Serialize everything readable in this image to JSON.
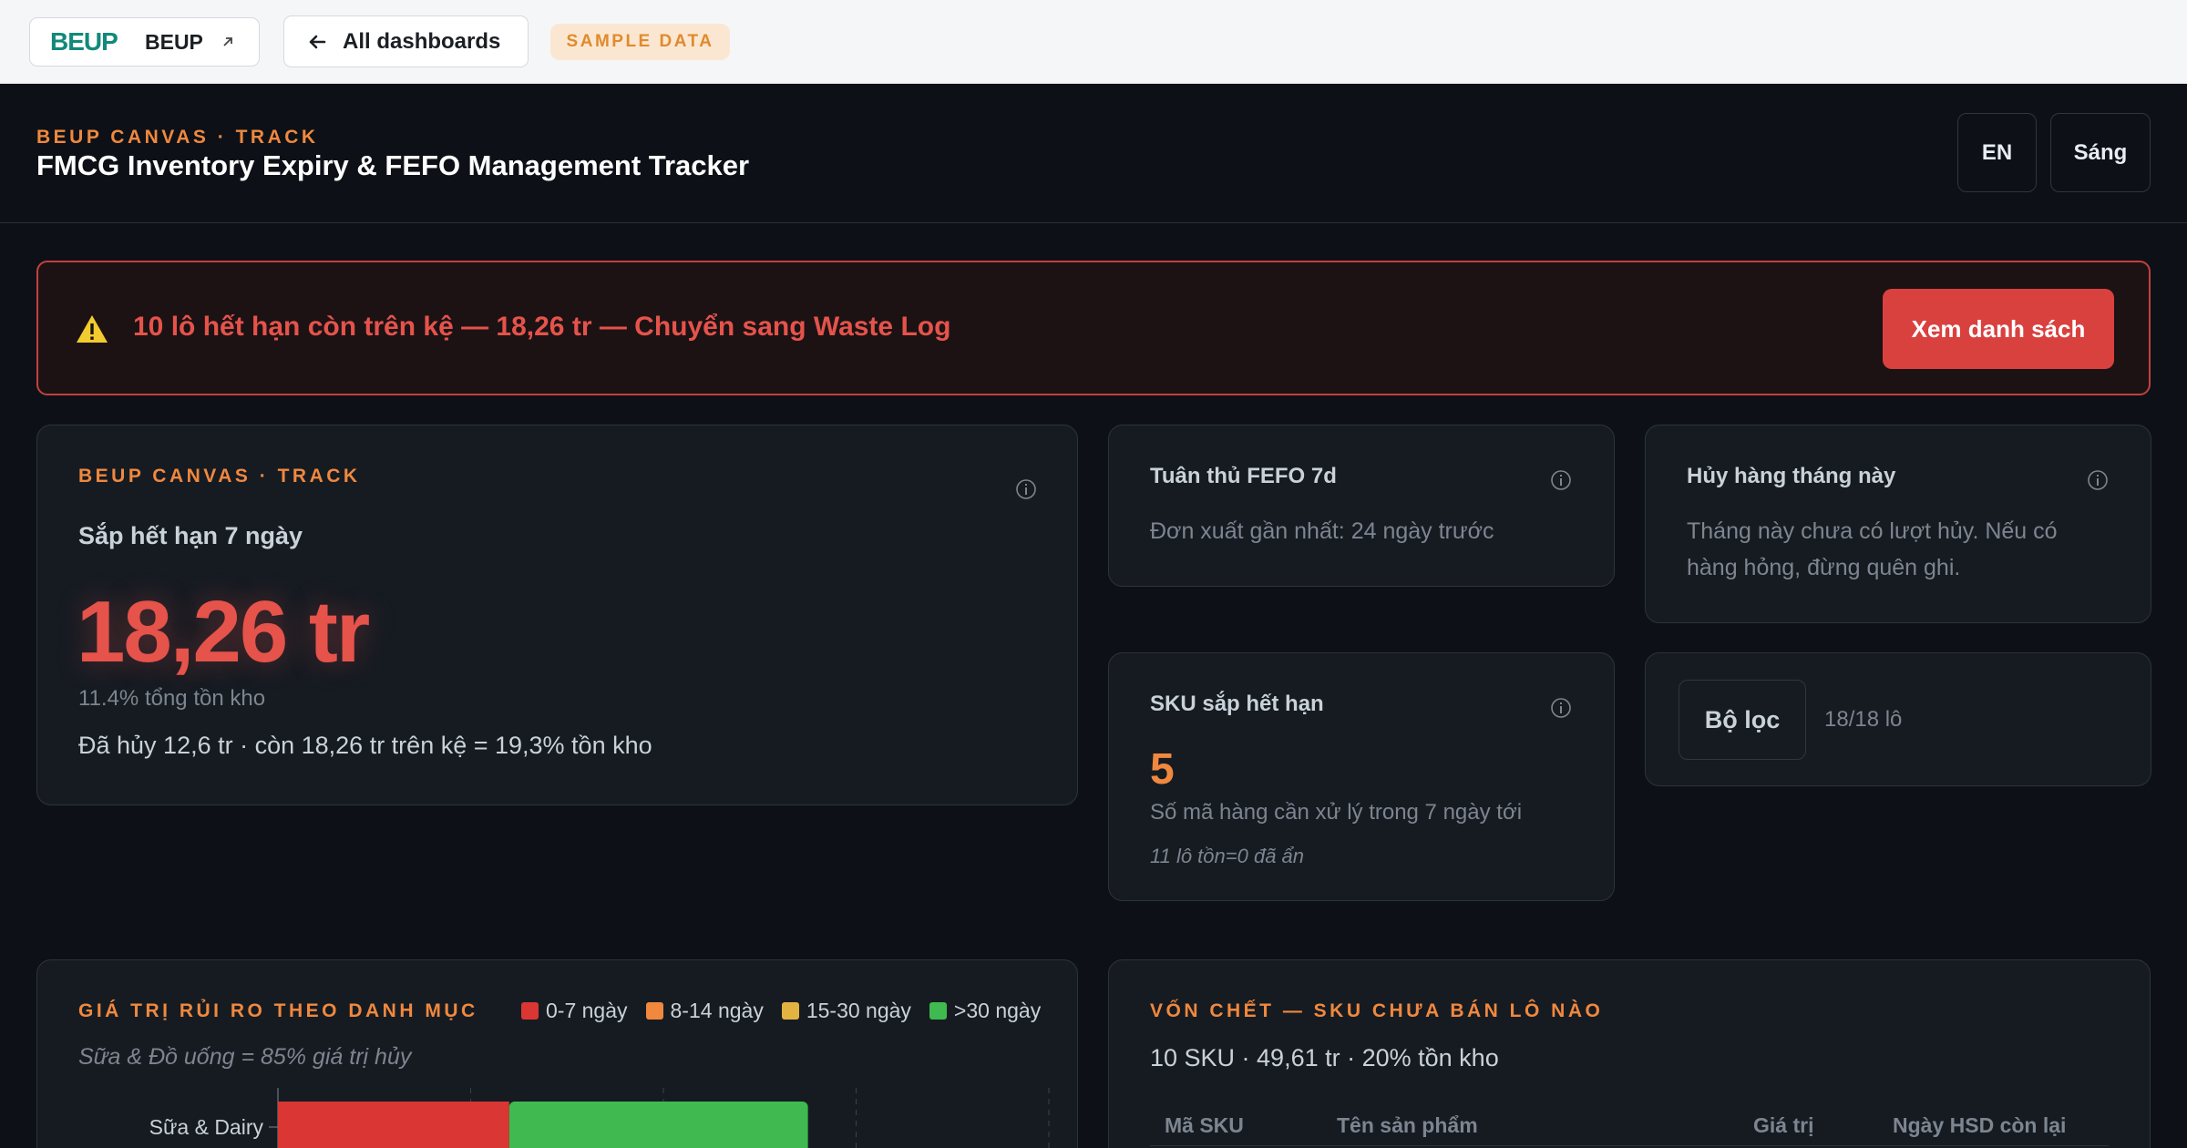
{
  "topbar": {
    "brand_logo": "BEUP",
    "brand_name": "BEUP",
    "back_label": "All dashboards",
    "sample_badge": "SAMPLE DATA"
  },
  "header": {
    "eyebrow": "BEUP CANVAS · TRACK",
    "title": "FMCG Inventory Expiry & FEFO Management Tracker",
    "lang_button": "EN",
    "theme_button": "Sáng"
  },
  "alert": {
    "text": "10 lô hết hạn còn trên kệ — 18,26 tr — Chuyển sang Waste Log",
    "button": "Xem danh sách"
  },
  "kpi_main": {
    "eyebrow": "BEUP CANVAS · TRACK",
    "label": "Sắp hết hạn 7 ngày",
    "value": "18,26 tr",
    "percent": "11.4% tổng tồn kho",
    "summary": "Đã hủy 12,6 tr · còn 18,26 tr trên kệ = 19,3% tồn kho"
  },
  "fefo": {
    "title": "Tuân thủ FEFO 7d",
    "text": "Đơn xuất gần nhất: 24 ngày trước"
  },
  "waste_month": {
    "title": "Hủy hàng tháng này",
    "text_line1": "Tháng này chưa có lượt hủy. Nếu có",
    "text_line2": "hàng hỏng, đừng quên ghi."
  },
  "sku_expiring": {
    "title": "SKU sắp hết hạn",
    "value": "5",
    "text": "Số mã hàng cần xử lý trong 7 ngày tới",
    "note": "11 lô tồn=0 đã ẩn"
  },
  "filter": {
    "button": "Bộ lọc",
    "count": "18/18 lô"
  },
  "risk_chart": {
    "eyebrow": "GIÁ TRỊ RỦI RO THEO DANH MỤC",
    "subtitle": "Sữa & Đồ uống = 85% giá trị hủy",
    "colors": {
      "d0_7": "#da3633",
      "d8_14": "#f0883e",
      "d15_30": "#e3b341",
      "d30p": "#3fb950"
    }
  },
  "chart_data": {
    "type": "bar",
    "orientation": "horizontal",
    "stacked": true,
    "categories": [
      "Sữa & Dairy"
    ],
    "series": [
      {
        "name": "0-7 ngày",
        "values": [
          12
        ]
      },
      {
        "name": "8-14 ngày",
        "values": [
          0
        ]
      },
      {
        "name": "15-30 ngày",
        "values": [
          0
        ]
      },
      {
        "name": ">30 ngày",
        "values": [
          15.5
        ]
      }
    ],
    "xlim": [
      0,
      40
    ],
    "grid": true,
    "legend": "top-right"
  },
  "dead_stock": {
    "eyebrow": "VỐN CHẾT — SKU CHƯA BÁN LÔ NÀO",
    "subtitle": "10 SKU · 49,61 tr · 20% tồn kho",
    "columns": [
      "Mã SKU",
      "Tên sản phẩm",
      "Giá trị",
      "Ngày HSD còn lại"
    ]
  }
}
